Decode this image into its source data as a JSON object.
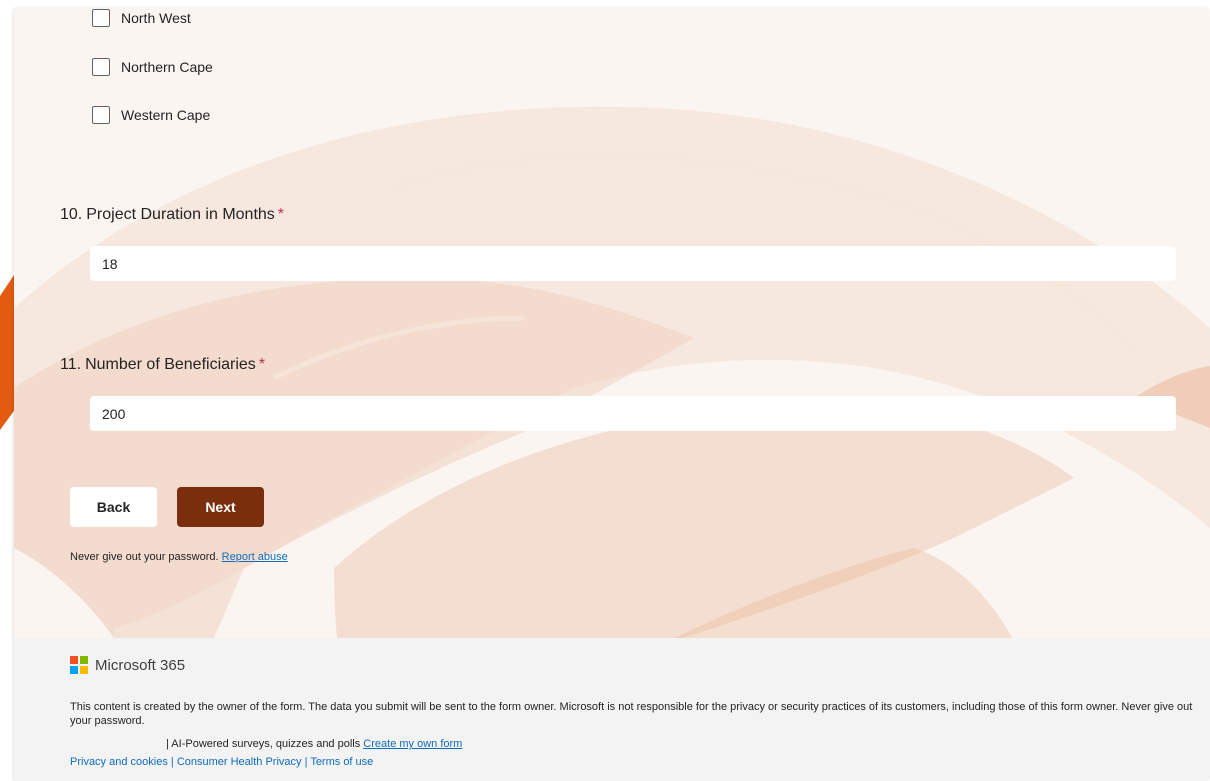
{
  "choices": [
    {
      "label": "North West",
      "checked": false
    },
    {
      "label": "Northern Cape",
      "checked": false
    },
    {
      "label": "Western Cape",
      "checked": false
    }
  ],
  "questions": [
    {
      "number": "10.",
      "title": "Project Duration in Months",
      "required_mark": "*",
      "value": "18"
    },
    {
      "number": "11.",
      "title": "Number of Beneficiaries",
      "required_mark": "*",
      "value": "200"
    }
  ],
  "buttons": {
    "back": "Back",
    "next": "Next"
  },
  "password_note": {
    "text": "Never give out your password.",
    "report_link": "Report abuse"
  },
  "footer": {
    "brand": "Microsoft 365",
    "disclaimer": "This content is created by the owner of the form. The data you submit will be sent to the form owner. Microsoft is not responsible for the privacy or security practices of its customers, including those of this form owner. Never give out your password.",
    "ai_text": "| AI-Powered surveys, quizzes and polls",
    "create_link": "Create my own form",
    "legal": {
      "privacy": "Privacy and cookies",
      "health": "Consumer Health Privacy",
      "terms": "Terms of use",
      "separator": "|"
    }
  },
  "colors": {
    "accent": "#7a2e0c",
    "orange_tab": "#e5590f",
    "required": "#c4314b",
    "link": "#0f6cbd"
  }
}
